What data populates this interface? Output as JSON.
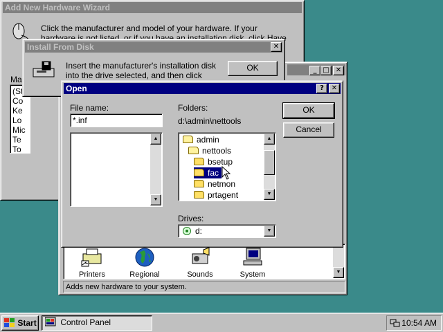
{
  "wizard": {
    "title": "Add New Hardware Wizard",
    "instruction": "Click the manufacturer and model of your hardware. If your hardware is not listed, or if you have an installation disk, click Have Disk.",
    "list_label": "Mar",
    "list_items": [
      "(St",
      "Co",
      "Ke",
      "Lo",
      "Mic",
      "Te",
      "To"
    ]
  },
  "install_from_disk": {
    "title": "Install From Disk",
    "close_glyph": "✕",
    "message": "Insert the manufacturer's installation disk into the drive selected, and then click OK.",
    "ok_label": "OK"
  },
  "control_panel": {
    "min_glyph": "_",
    "max_glyph": "□",
    "close_glyph": "✕",
    "icons": [
      {
        "label": "Printers",
        "icon": "printer-icon"
      },
      {
        "label": "Regional",
        "icon": "globe-icon"
      },
      {
        "label": "Sounds",
        "icon": "speaker-icon"
      },
      {
        "label": "System",
        "icon": "computer-icon"
      }
    ],
    "status": "Adds new hardware to your system."
  },
  "open_dialog": {
    "title": "Open",
    "help_glyph": "?",
    "close_glyph": "✕",
    "file_name_label": "File name:",
    "file_name_value": "*.inf",
    "folders_label": "Folders:",
    "current_path": "d:\\admin\\nettools",
    "folders": [
      {
        "name": "admin",
        "indent": 0,
        "open": true,
        "selected": false
      },
      {
        "name": "nettools",
        "indent": 1,
        "open": true,
        "selected": false
      },
      {
        "name": "bsetup",
        "indent": 2,
        "open": false,
        "selected": false
      },
      {
        "name": "fac",
        "indent": 2,
        "open": false,
        "selected": true
      },
      {
        "name": "netmon",
        "indent": 2,
        "open": false,
        "selected": false
      },
      {
        "name": "prtagent",
        "indent": 2,
        "open": false,
        "selected": false
      }
    ],
    "drives_label": "Drives:",
    "drive_value": "d:",
    "ok_label": "OK",
    "cancel_label": "Cancel"
  },
  "taskbar": {
    "start_label": "Start",
    "task_label": "Control Panel",
    "time": "10:54 AM"
  },
  "colors": {
    "desktop": "#3a8a8a",
    "active_title": "#000080",
    "inactive_title": "#808080",
    "face": "#c0c0c0"
  }
}
